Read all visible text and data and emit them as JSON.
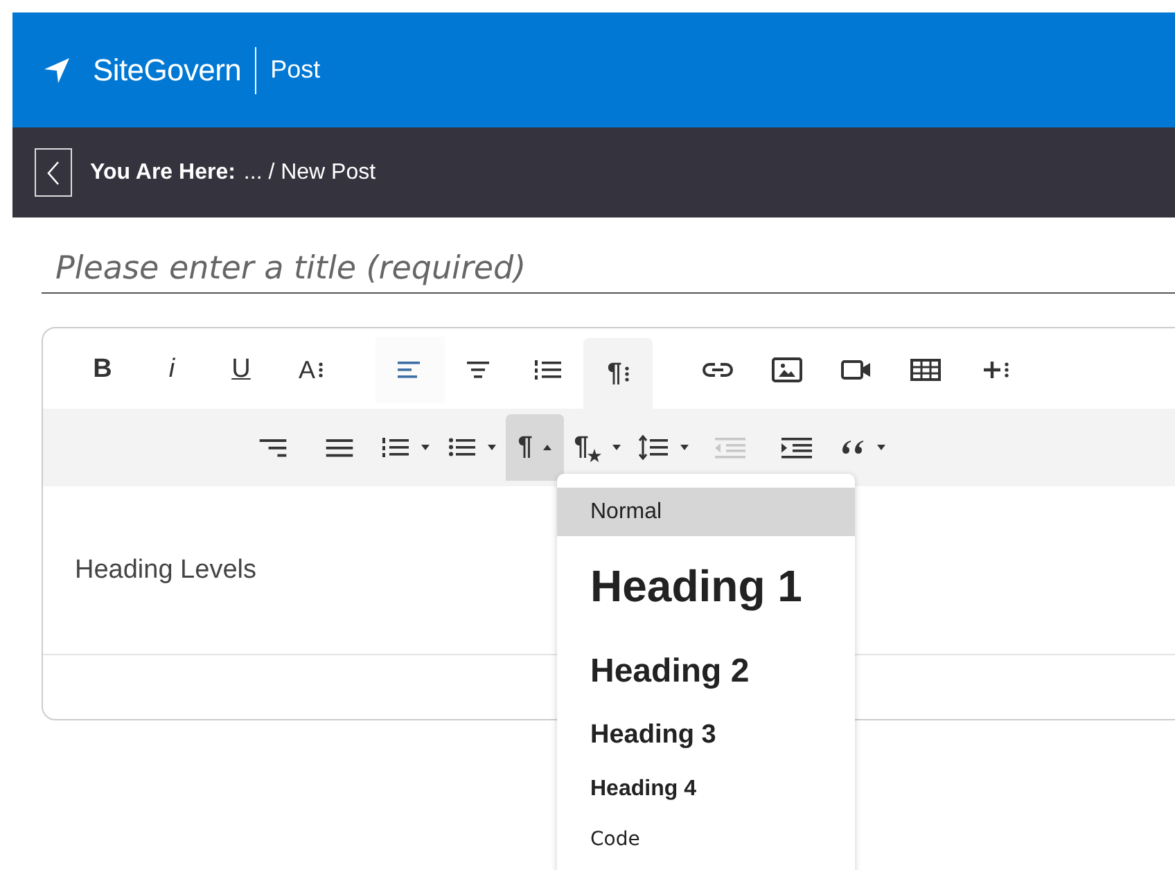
{
  "header": {
    "brand": "SiteGovern",
    "section": "Post"
  },
  "breadcrumb": {
    "label": "You Are Here:",
    "path": "... / New Post"
  },
  "title_field": {
    "placeholder": "Please enter a title (required)"
  },
  "toolbar": {
    "row_1": [
      {
        "kind": "bold",
        "text": "B",
        "active": false,
        "selected": false,
        "disabled": false
      },
      {
        "kind": "italic",
        "text": "i",
        "active": false,
        "selected": false,
        "disabled": false
      },
      {
        "kind": "underline",
        "text": "U",
        "active": false,
        "selected": false,
        "disabled": false
      },
      {
        "kind": "text-more",
        "text": "A",
        "active": false,
        "selected": false,
        "disabled": false
      },
      {
        "kind": "align-left",
        "active": true,
        "selected": false,
        "disabled": false
      },
      {
        "kind": "align-center",
        "active": false,
        "selected": false,
        "disabled": false
      },
      {
        "kind": "ordered-list",
        "active": false,
        "selected": false,
        "disabled": false
      },
      {
        "kind": "paragraph-more",
        "text": "¶",
        "active": false,
        "selected": true,
        "disabled": false
      },
      {
        "kind": "link",
        "active": false,
        "selected": false,
        "disabled": false
      },
      {
        "kind": "image",
        "active": false,
        "selected": false,
        "disabled": false
      },
      {
        "kind": "video",
        "active": false,
        "selected": false,
        "disabled": false
      },
      {
        "kind": "table",
        "active": false,
        "selected": false,
        "disabled": false
      },
      {
        "kind": "insert-more",
        "active": false,
        "selected": false,
        "disabled": false
      }
    ],
    "row_2": [
      {
        "kind": "align-right",
        "caret": false,
        "selected": false,
        "disabled": false
      },
      {
        "kind": "justify",
        "caret": false,
        "selected": false,
        "disabled": false
      },
      {
        "kind": "ordered-list",
        "caret": true,
        "selected": false,
        "disabled": false
      },
      {
        "kind": "unordered-list",
        "caret": true,
        "selected": false,
        "disabled": false
      },
      {
        "kind": "paragraph-format",
        "text": "¶",
        "caret": true,
        "selected": true,
        "disabled": false
      },
      {
        "kind": "paragraph-style",
        "text": "¶",
        "caret": true,
        "selected": false,
        "disabled": false
      },
      {
        "kind": "line-height",
        "caret": true,
        "selected": false,
        "disabled": false
      },
      {
        "kind": "outdent",
        "caret": false,
        "selected": false,
        "disabled": true
      },
      {
        "kind": "indent",
        "caret": false,
        "selected": false,
        "disabled": false
      },
      {
        "kind": "quote",
        "caret": true,
        "selected": false,
        "disabled": false
      }
    ]
  },
  "content": {
    "text": "Heading Levels"
  },
  "paragraph_menu": [
    {
      "kind": "normal",
      "label": "Normal",
      "selected": true
    },
    {
      "kind": "h1",
      "label": "Heading 1",
      "selected": false
    },
    {
      "kind": "h2",
      "label": "Heading 2",
      "selected": false
    },
    {
      "kind": "h3",
      "label": "Heading 3",
      "selected": false
    },
    {
      "kind": "h4",
      "label": "Heading 4",
      "selected": false
    },
    {
      "kind": "code",
      "label": "Code",
      "selected": false
    }
  ]
}
